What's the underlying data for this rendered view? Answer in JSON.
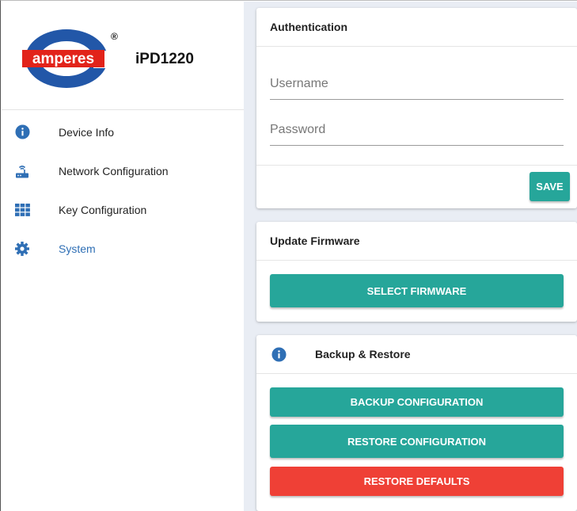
{
  "brand": {
    "logo_text": "amperes",
    "registered": "®",
    "model": "iPD1220"
  },
  "colors": {
    "teal": "#26a69a",
    "red": "#ef4036",
    "blue": "#2f6fb5",
    "logo_red": "#e2231a",
    "background": "#e9edf4"
  },
  "sidebar": {
    "items": [
      {
        "label": "Device Info",
        "icon": "info-icon",
        "active": false
      },
      {
        "label": "Network Configuration",
        "icon": "router-icon",
        "active": false
      },
      {
        "label": "Key Configuration",
        "icon": "grid-icon",
        "active": false
      },
      {
        "label": "System",
        "icon": "gear-icon",
        "active": true
      }
    ]
  },
  "authentication": {
    "title": "Authentication",
    "username_placeholder": "Username",
    "password_placeholder": "Password",
    "save_label": "SAVE"
  },
  "firmware": {
    "title": "Update Firmware",
    "select_label": "SELECT FIRMWARE"
  },
  "backup": {
    "title": "Backup & Restore",
    "backup_label": "BACKUP CONFIGURATION",
    "restore_label": "RESTORE CONFIGURATION",
    "defaults_label": "RESTORE DEFAULTS"
  }
}
